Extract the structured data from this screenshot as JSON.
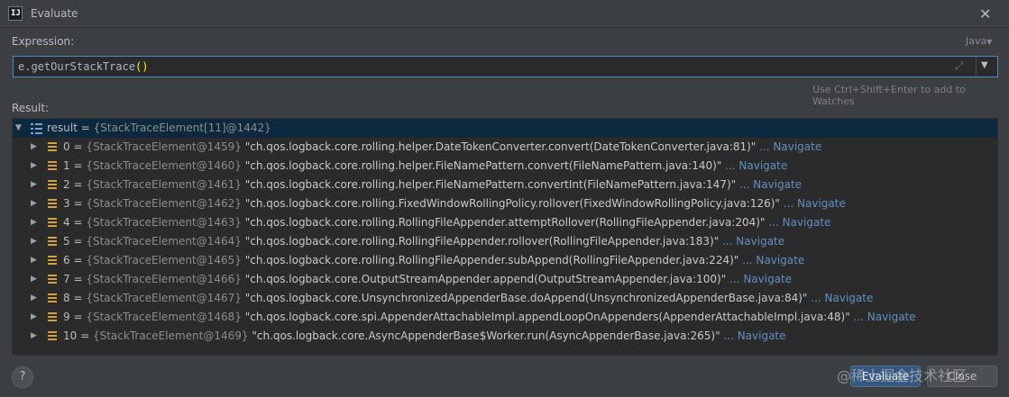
{
  "window": {
    "title": "Evaluate",
    "app_icon_text": "IJ"
  },
  "expression": {
    "label": "Expression:",
    "language": "Java",
    "code": "e.getOurStackTrace",
    "code_parens": "()",
    "hint": "Use Ctrl+Shift+Enter to add to Watches"
  },
  "result": {
    "label": "Result:",
    "root": {
      "name": "result",
      "eq": " = ",
      "type": "{StackTraceElement[11]@1442}"
    },
    "navigate_label": "... Navigate",
    "items": [
      {
        "index": "0",
        "type": "{StackTraceElement@1459}",
        "value": "\"ch.qos.logback.core.rolling.helper.DateTokenConverter.convert(DateTokenConverter.java:81)\""
      },
      {
        "index": "1",
        "type": "{StackTraceElement@1460}",
        "value": "\"ch.qos.logback.core.rolling.helper.FileNamePattern.convert(FileNamePattern.java:140)\""
      },
      {
        "index": "2",
        "type": "{StackTraceElement@1461}",
        "value": "\"ch.qos.logback.core.rolling.helper.FileNamePattern.convertInt(FileNamePattern.java:147)\""
      },
      {
        "index": "3",
        "type": "{StackTraceElement@1462}",
        "value": "\"ch.qos.logback.core.rolling.FixedWindowRollingPolicy.rollover(FixedWindowRollingPolicy.java:126)\""
      },
      {
        "index": "4",
        "type": "{StackTraceElement@1463}",
        "value": "\"ch.qos.logback.core.rolling.RollingFileAppender.attemptRollover(RollingFileAppender.java:204)\""
      },
      {
        "index": "5",
        "type": "{StackTraceElement@1464}",
        "value": "\"ch.qos.logback.core.rolling.RollingFileAppender.rollover(RollingFileAppender.java:183)\""
      },
      {
        "index": "6",
        "type": "{StackTraceElement@1465}",
        "value": "\"ch.qos.logback.core.rolling.RollingFileAppender.subAppend(RollingFileAppender.java:224)\""
      },
      {
        "index": "7",
        "type": "{StackTraceElement@1466}",
        "value": "\"ch.qos.logback.core.OutputStreamAppender.append(OutputStreamAppender.java:100)\""
      },
      {
        "index": "8",
        "type": "{StackTraceElement@1467}",
        "value": "\"ch.qos.logback.core.UnsynchronizedAppenderBase.doAppend(UnsynchronizedAppenderBase.java:84)\""
      },
      {
        "index": "9",
        "type": "{StackTraceElement@1468}",
        "value": "\"ch.qos.logback.core.spi.AppenderAttachableImpl.appendLoopOnAppenders(AppenderAttachableImpl.java:48)\""
      },
      {
        "index": "10",
        "type": "{StackTraceElement@1469}",
        "value": "\"ch.qos.logback.core.AsyncAppenderBase$Worker.run(AsyncAppenderBase.java:265)\""
      }
    ]
  },
  "footer": {
    "help": "?",
    "evaluate_label": "Evaluate",
    "close_label": "Close",
    "watermark": "@稀土掘金技术社区"
  },
  "icons": [
    "app-icon",
    "close-icon",
    "dropdown-arrow-icon",
    "expand-editor-icon",
    "array-icon",
    "field-icon",
    "tree-expand-icon",
    "tree-collapse-icon",
    "help-icon"
  ],
  "colors": {
    "background": "#3c3f41",
    "editor": "#2b2b2b",
    "focus_border": "#4a88c7",
    "selection": "#0d293e",
    "navigate_link": "#5f8fc2",
    "field_icon": "#d7a13a",
    "array_icon": "#6aa7e0"
  }
}
